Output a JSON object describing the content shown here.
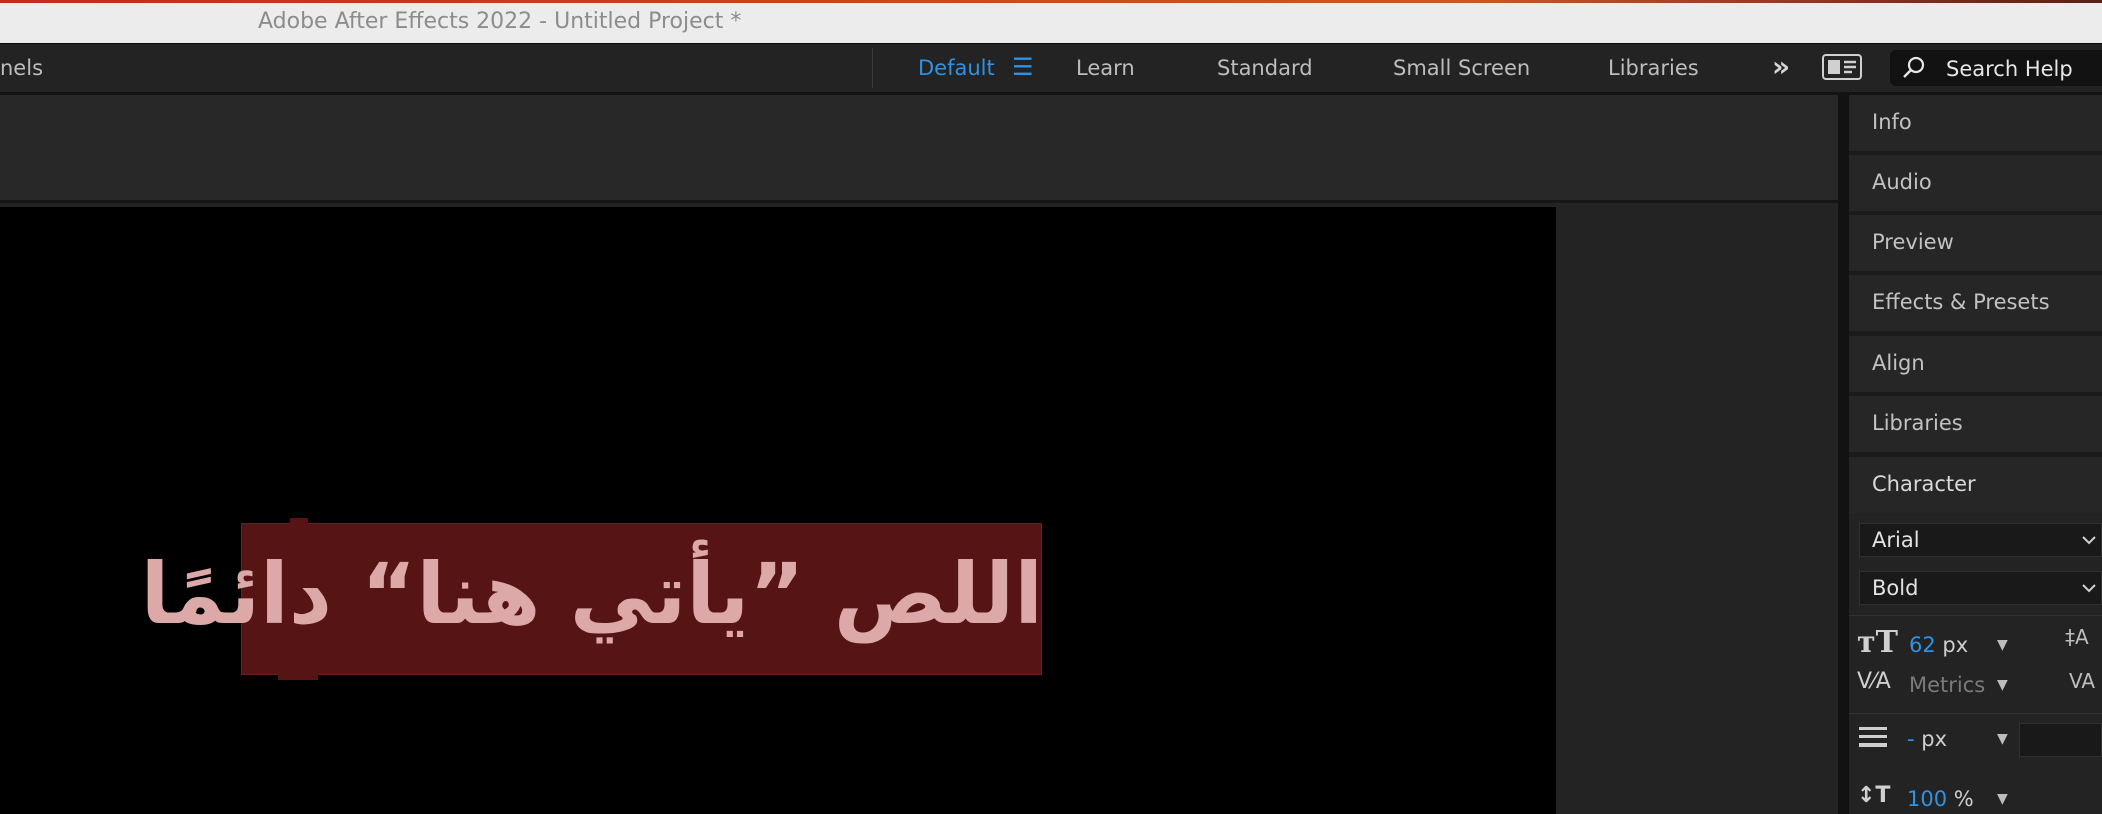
{
  "window": {
    "title": "Adobe After Effects 2022 - Untitled Project *"
  },
  "toolbar": {
    "panels_label": "nels",
    "workspaces": [
      "Default",
      "Learn",
      "Standard",
      "Small Screen",
      "Libraries"
    ],
    "active_workspace": "Default",
    "more_label": "»",
    "search_label": "Search Help"
  },
  "viewer": {
    "text_layer": "اللص ”يأتي هنا“ دائمًا"
  },
  "right_panels": [
    "Info",
    "Audio",
    "Preview",
    "Effects & Presets",
    "Align",
    "Libraries"
  ],
  "character": {
    "title": "Character",
    "font_family": "Arial",
    "font_style": "Bold",
    "font_size_value": "62",
    "font_size_unit": "px",
    "kerning": "Metrics",
    "stroke_value": "-",
    "stroke_unit": "px",
    "vscale_value": "100",
    "vscale_unit": "%"
  },
  "colors": {
    "accent_blue": "#2e92e6",
    "text_highlight": "#561414",
    "text_fill": "#dca8a8"
  }
}
